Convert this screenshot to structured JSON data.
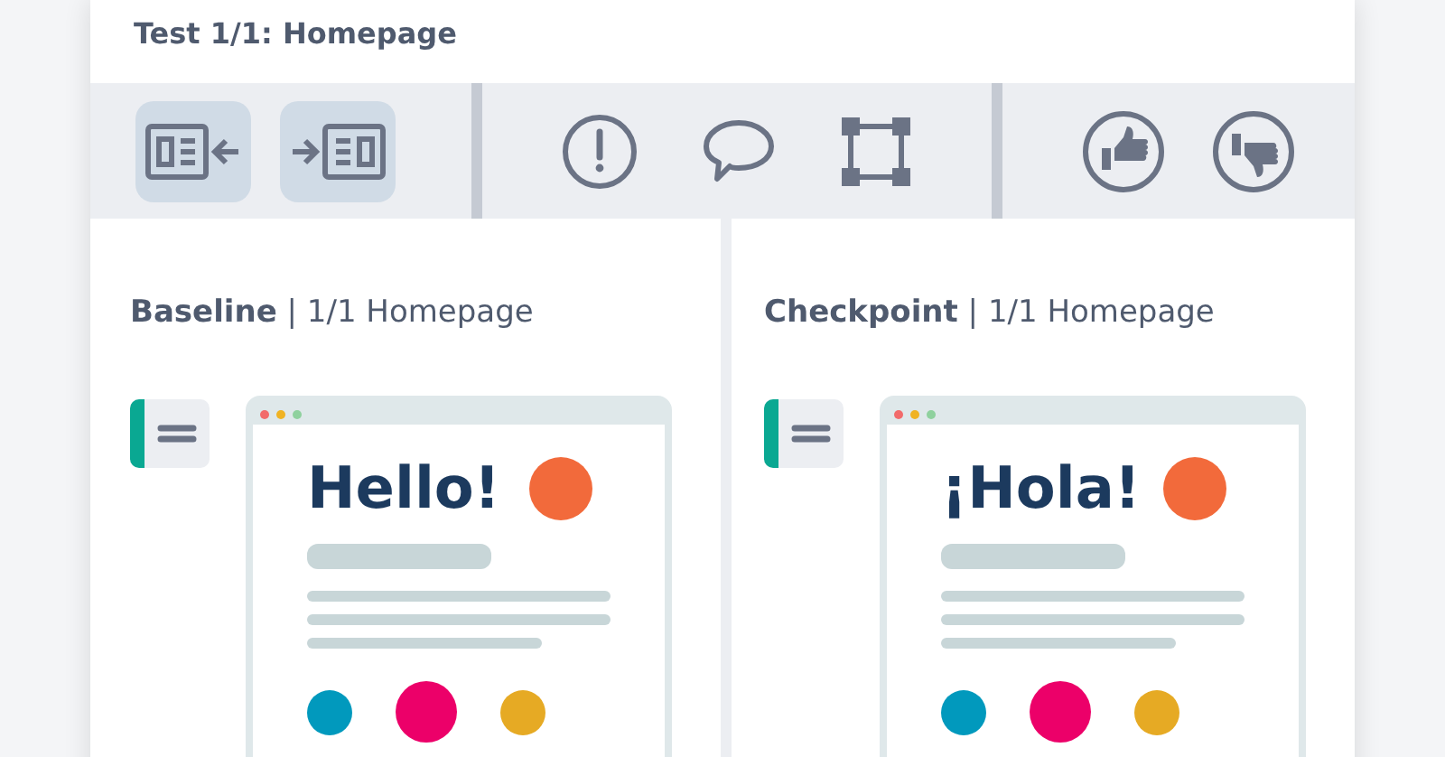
{
  "title": "Test 1/1: Homepage",
  "view_buttons": [
    {
      "on": true
    },
    {
      "on": true
    }
  ],
  "panes": [
    {
      "title": "**Baseline** | 1/1 Homepage",
      "heading": "Hello!"
    },
    {
      "title": "**Checkpoint** | 1/1 Homepage",
      "heading": "¡Hola!"
    }
  ]
}
